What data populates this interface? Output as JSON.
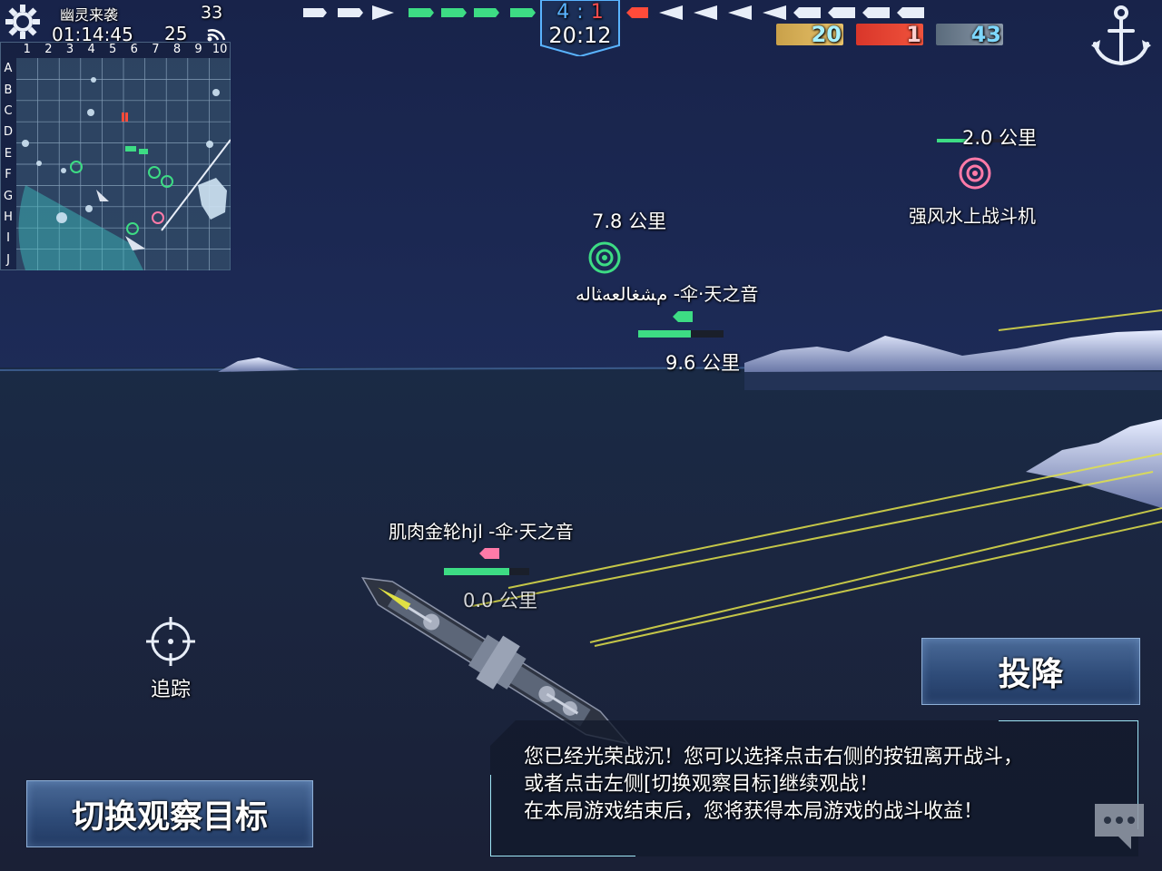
{
  "hud": {
    "mode_name": "幽灵来袭",
    "elapsed_time": "01:14:45",
    "ping": "33",
    "fps": "25"
  },
  "minimap": {
    "columns": [
      "1",
      "2",
      "3",
      "4",
      "5",
      "6",
      "7",
      "8",
      "9",
      "10"
    ],
    "rows": [
      "A",
      "B",
      "C",
      "D",
      "E",
      "F",
      "G",
      "H",
      "I",
      "J"
    ]
  },
  "match": {
    "score_ally": "4",
    "score_sep": ":",
    "score_enemy": "1",
    "timer": "20:12"
  },
  "resources": {
    "aircraft_gold": "20",
    "aircraft_red": "1",
    "ammo_grey": "43"
  },
  "world": {
    "fighter_distance": "2.0 公里",
    "fighter_name": "强风水上战斗机",
    "ally1_distance": "7.8 公里",
    "ally1_name": "ﻡﺸﻐﺎﻟﻌﻪﺜﺎﻟﻪ -伞·天之音",
    "ally1_distance2": "9.6 公里",
    "player_name": "肌肉金轮hjl -伞·天之音",
    "player_distance": "0.0 公里"
  },
  "controls": {
    "track_label": "追踪",
    "surrender_label": "投降",
    "switch_label": "切换观察目标"
  },
  "message": {
    "text": "您已经光荣战沉！您可以选择点击右侧的按钮离开战斗，\n或者点击左侧[切换观察目标]继续观战！\n在本局游戏结束后，您将获得本局游戏的战斗收益！"
  },
  "icons": {
    "settings": "gear-icon",
    "signal": "wifi-icon",
    "anchor": "anchor-icon",
    "target": "crosshair-icon",
    "chat": "chat-icon"
  },
  "colors": {
    "ally": "#3ddc84",
    "enemy": "#ff5a4a",
    "target_pink": "#ff7aa8",
    "score_blue": "#5ab4ff"
  }
}
